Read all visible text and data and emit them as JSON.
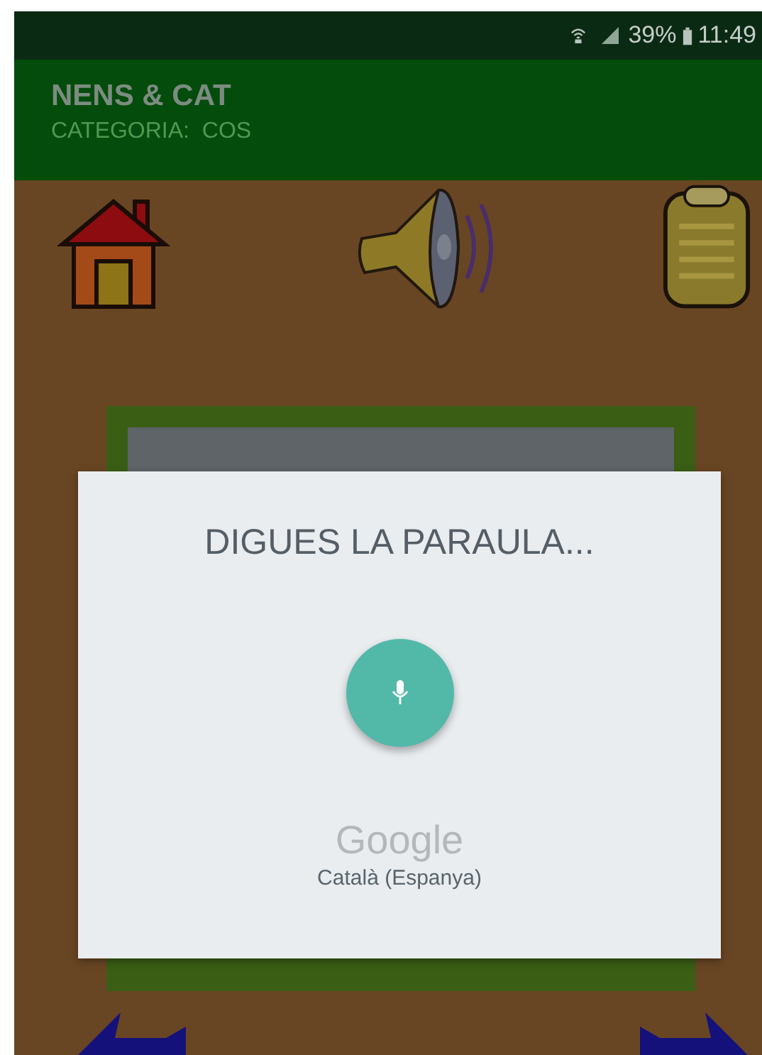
{
  "status_bar": {
    "battery": "39%",
    "time": "11:49"
  },
  "app_bar": {
    "title": "NENS & CAT",
    "subtitle": "CATEGORIA:  COS"
  },
  "dialog": {
    "prompt": "DIGUES LA PARAULA...",
    "brand": "Google",
    "language": "Català (Espanya)"
  }
}
